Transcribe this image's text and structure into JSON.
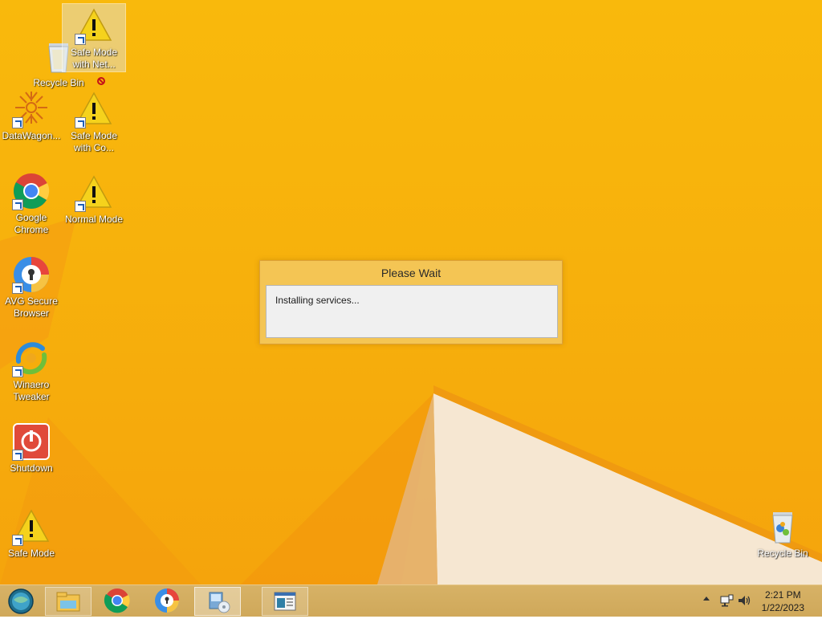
{
  "desktop": {
    "icons": [
      {
        "label": "Recycle Bin",
        "icon": "recycle-bin-icon"
      },
      {
        "label": "Safe Mode with Net...",
        "icon": "warning-icon"
      },
      {
        "label": "DataWagon...",
        "icon": "datawagon-icon"
      },
      {
        "label": "Safe Mode with Co...",
        "icon": "warning-icon"
      },
      {
        "label": "Google Chrome",
        "icon": "chrome-icon"
      },
      {
        "label": "Normal Mode",
        "icon": "warning-icon"
      },
      {
        "label": "AVG Secure Browser",
        "icon": "avg-secure-browser-icon"
      },
      {
        "label": "Winaero Tweaker",
        "icon": "winaero-tweaker-icon"
      },
      {
        "label": "Shutdown",
        "icon": "power-icon"
      },
      {
        "label": "Safe Mode",
        "icon": "warning-icon"
      },
      {
        "label": "Recycle Bin",
        "icon": "recycle-bin-icon"
      }
    ]
  },
  "dialog": {
    "title": "Please Wait",
    "message": "Installing services..."
  },
  "taskbar": {
    "start": "start-orb-icon",
    "buttons": [
      "file-explorer-icon",
      "chrome-icon",
      "avg-secure-browser-icon",
      "computer-setup-icon",
      "window-app-icon"
    ]
  },
  "tray": {
    "time": "2:21 PM",
    "date": "1/22/2023",
    "icons": [
      "show-hidden-icons-chevron",
      "network-icon",
      "volume-icon"
    ]
  },
  "colors": {
    "desktop_accent": "#f7b10c",
    "taskbar": "#d3ad5f",
    "dialog_frame": "#f4c554"
  }
}
